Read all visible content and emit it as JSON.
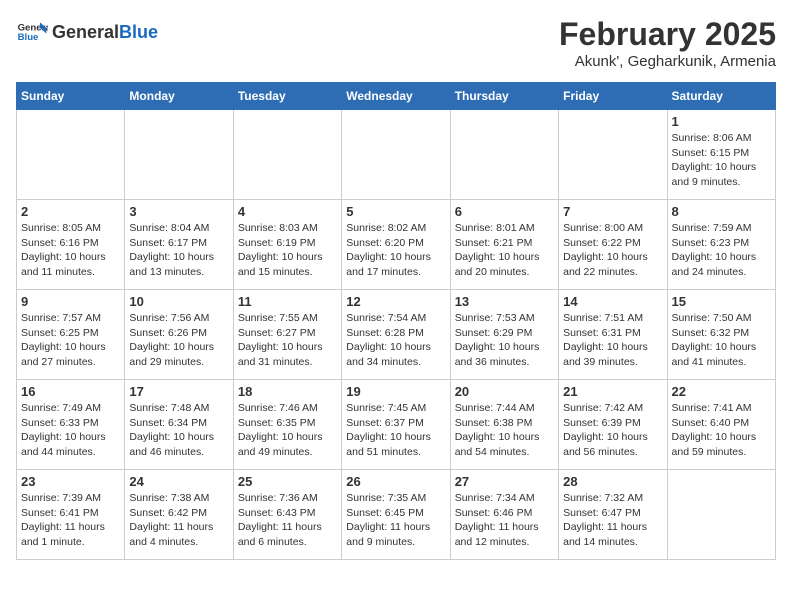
{
  "header": {
    "logo_general": "General",
    "logo_blue": "Blue",
    "title": "February 2025",
    "subtitle": "Akunk', Gegharkunik, Armenia"
  },
  "calendar": {
    "days_of_week": [
      "Sunday",
      "Monday",
      "Tuesday",
      "Wednesday",
      "Thursday",
      "Friday",
      "Saturday"
    ],
    "weeks": [
      [
        {
          "day": "",
          "detail": ""
        },
        {
          "day": "",
          "detail": ""
        },
        {
          "day": "",
          "detail": ""
        },
        {
          "day": "",
          "detail": ""
        },
        {
          "day": "",
          "detail": ""
        },
        {
          "day": "",
          "detail": ""
        },
        {
          "day": "1",
          "detail": "Sunrise: 8:06 AM\nSunset: 6:15 PM\nDaylight: 10 hours and 9 minutes."
        }
      ],
      [
        {
          "day": "2",
          "detail": "Sunrise: 8:05 AM\nSunset: 6:16 PM\nDaylight: 10 hours and 11 minutes."
        },
        {
          "day": "3",
          "detail": "Sunrise: 8:04 AM\nSunset: 6:17 PM\nDaylight: 10 hours and 13 minutes."
        },
        {
          "day": "4",
          "detail": "Sunrise: 8:03 AM\nSunset: 6:19 PM\nDaylight: 10 hours and 15 minutes."
        },
        {
          "day": "5",
          "detail": "Sunrise: 8:02 AM\nSunset: 6:20 PM\nDaylight: 10 hours and 17 minutes."
        },
        {
          "day": "6",
          "detail": "Sunrise: 8:01 AM\nSunset: 6:21 PM\nDaylight: 10 hours and 20 minutes."
        },
        {
          "day": "7",
          "detail": "Sunrise: 8:00 AM\nSunset: 6:22 PM\nDaylight: 10 hours and 22 minutes."
        },
        {
          "day": "8",
          "detail": "Sunrise: 7:59 AM\nSunset: 6:23 PM\nDaylight: 10 hours and 24 minutes."
        }
      ],
      [
        {
          "day": "9",
          "detail": "Sunrise: 7:57 AM\nSunset: 6:25 PM\nDaylight: 10 hours and 27 minutes."
        },
        {
          "day": "10",
          "detail": "Sunrise: 7:56 AM\nSunset: 6:26 PM\nDaylight: 10 hours and 29 minutes."
        },
        {
          "day": "11",
          "detail": "Sunrise: 7:55 AM\nSunset: 6:27 PM\nDaylight: 10 hours and 31 minutes."
        },
        {
          "day": "12",
          "detail": "Sunrise: 7:54 AM\nSunset: 6:28 PM\nDaylight: 10 hours and 34 minutes."
        },
        {
          "day": "13",
          "detail": "Sunrise: 7:53 AM\nSunset: 6:29 PM\nDaylight: 10 hours and 36 minutes."
        },
        {
          "day": "14",
          "detail": "Sunrise: 7:51 AM\nSunset: 6:31 PM\nDaylight: 10 hours and 39 minutes."
        },
        {
          "day": "15",
          "detail": "Sunrise: 7:50 AM\nSunset: 6:32 PM\nDaylight: 10 hours and 41 minutes."
        }
      ],
      [
        {
          "day": "16",
          "detail": "Sunrise: 7:49 AM\nSunset: 6:33 PM\nDaylight: 10 hours and 44 minutes."
        },
        {
          "day": "17",
          "detail": "Sunrise: 7:48 AM\nSunset: 6:34 PM\nDaylight: 10 hours and 46 minutes."
        },
        {
          "day": "18",
          "detail": "Sunrise: 7:46 AM\nSunset: 6:35 PM\nDaylight: 10 hours and 49 minutes."
        },
        {
          "day": "19",
          "detail": "Sunrise: 7:45 AM\nSunset: 6:37 PM\nDaylight: 10 hours and 51 minutes."
        },
        {
          "day": "20",
          "detail": "Sunrise: 7:44 AM\nSunset: 6:38 PM\nDaylight: 10 hours and 54 minutes."
        },
        {
          "day": "21",
          "detail": "Sunrise: 7:42 AM\nSunset: 6:39 PM\nDaylight: 10 hours and 56 minutes."
        },
        {
          "day": "22",
          "detail": "Sunrise: 7:41 AM\nSunset: 6:40 PM\nDaylight: 10 hours and 59 minutes."
        }
      ],
      [
        {
          "day": "23",
          "detail": "Sunrise: 7:39 AM\nSunset: 6:41 PM\nDaylight: 11 hours and 1 minute."
        },
        {
          "day": "24",
          "detail": "Sunrise: 7:38 AM\nSunset: 6:42 PM\nDaylight: 11 hours and 4 minutes."
        },
        {
          "day": "25",
          "detail": "Sunrise: 7:36 AM\nSunset: 6:43 PM\nDaylight: 11 hours and 6 minutes."
        },
        {
          "day": "26",
          "detail": "Sunrise: 7:35 AM\nSunset: 6:45 PM\nDaylight: 11 hours and 9 minutes."
        },
        {
          "day": "27",
          "detail": "Sunrise: 7:34 AM\nSunset: 6:46 PM\nDaylight: 11 hours and 12 minutes."
        },
        {
          "day": "28",
          "detail": "Sunrise: 7:32 AM\nSunset: 6:47 PM\nDaylight: 11 hours and 14 minutes."
        },
        {
          "day": "",
          "detail": ""
        }
      ]
    ]
  }
}
